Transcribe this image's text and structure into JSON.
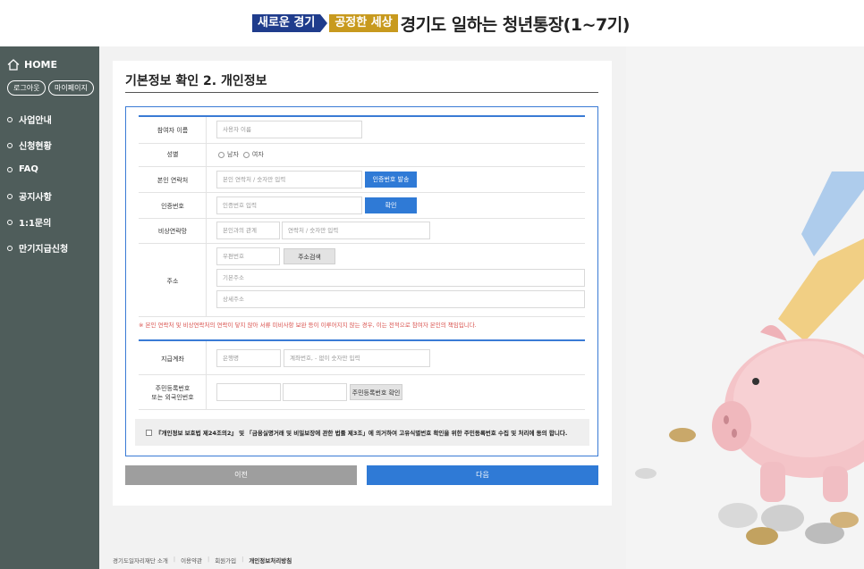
{
  "header": {
    "badge1": "새로운 경기",
    "badge2": "공정한 세상",
    "title": "경기도 일하는 청년통장(1~7기)"
  },
  "sidebar": {
    "home": "HOME",
    "logout": "로그아웃",
    "mypage": "마이페이지",
    "items": [
      {
        "label": "사업안내"
      },
      {
        "label": "신청현황"
      },
      {
        "label": "FAQ"
      },
      {
        "label": "공지사항"
      },
      {
        "label": "1:1문의"
      },
      {
        "label": "만기지급신청"
      }
    ]
  },
  "page": {
    "title": "기본정보 확인 2. 개인정보"
  },
  "form": {
    "name_label": "참여자 이름",
    "name_placeholder": "사용자 이름",
    "gender_label": "성별",
    "gender_male": "남자",
    "gender_female": "여자",
    "phone_label": "본인 연락처",
    "phone_placeholder": "본인 연락처 / 숫자만 입력",
    "send_code_button": "인증번호 발송",
    "code_label": "인증번호",
    "code_placeholder": "인증번호 입력",
    "confirm_button": "확인",
    "emergency_label": "비상연락망",
    "relation_placeholder": "본인과의 관계",
    "emergency_phone_placeholder": "연락처 / 숫자만 입력",
    "address_label": "주소",
    "zip_placeholder": "우편번호",
    "address_search_button": "주소검색",
    "address1_placeholder": "기본주소",
    "address2_placeholder": "상세주소",
    "notice": "※ 본인 연락처 및 비상연락처의 연락이 닿지 않아 서류 미비사항 보완 등이 이루어지지 않는 경우, 이는 전적으로 참여자 본인의 책임입니다.",
    "bank_label": "지급계좌",
    "bank_placeholder": "은행명",
    "account_placeholder": "계좌번호, - 없이 숫자만 입력",
    "rrn_label_line1": "주민등록번호",
    "rrn_label_line2": "또는 외국인번호",
    "rrn_check_button": "주민등록번호 확인",
    "agree_text": "『개인정보 보호법 제24조의2』 및 「금융실명거래 및 비밀보장에 관한 법률 제3조」에 의거하여 고유식별번호 확인을 위한 주민등록번호 수집 및 처리에 동의 합니다."
  },
  "buttons": {
    "prev": "이전",
    "next": "다음"
  },
  "footer": {
    "links": [
      "경기도일자리재단 소개",
      "이용약관",
      "회원가입",
      "개인정보처리방침"
    ]
  },
  "colors": {
    "accent": "#2f7ad6",
    "sidebar": "#4f5d5b",
    "badge_blue": "#1f3c8c",
    "badge_gold": "#c89a1e",
    "notice_red": "#d9534f"
  }
}
